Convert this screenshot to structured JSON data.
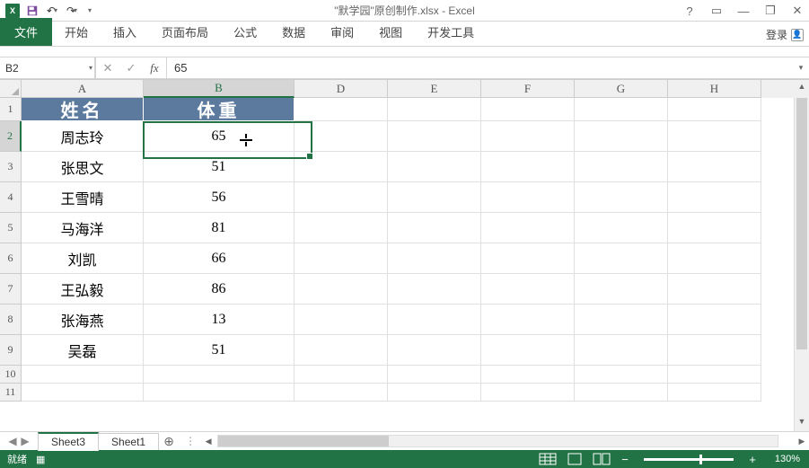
{
  "app": {
    "title": "\"默学园\"原创制作.xlsx - Excel"
  },
  "qat": {
    "undo": "↶",
    "redo": "↷"
  },
  "winbuttons": {
    "help": "?",
    "ribbon": "▭",
    "min": "—",
    "restore": "❐",
    "close": "✕"
  },
  "ribbon": {
    "file": "文件",
    "tabs": [
      "开始",
      "插入",
      "页面布局",
      "公式",
      "数据",
      "审阅",
      "视图",
      "开发工具"
    ],
    "login": "登录"
  },
  "formula_bar": {
    "name_box": "B2",
    "cancel": "✕",
    "enter": "✓",
    "fx": "fx",
    "value": "65"
  },
  "columns": [
    "A",
    "B",
    "D",
    "E",
    "F",
    "G",
    "H"
  ],
  "selected_column": "B",
  "selected_row": "2",
  "header_row": {
    "a": "姓名",
    "b": "体重"
  },
  "data_rows": [
    {
      "n": "2",
      "a": "周志玲",
      "b": "65"
    },
    {
      "n": "3",
      "a": "张思文",
      "b": "51"
    },
    {
      "n": "4",
      "a": "王雪晴",
      "b": "56"
    },
    {
      "n": "5",
      "a": "马海洋",
      "b": "81"
    },
    {
      "n": "6",
      "a": "刘凯",
      "b": "66"
    },
    {
      "n": "7",
      "a": "王弘毅",
      "b": "86"
    },
    {
      "n": "8",
      "a": "张海燕",
      "b": "13"
    },
    {
      "n": "9",
      "a": "吴磊",
      "b": "51"
    }
  ],
  "empty_rows": [
    "10",
    "11"
  ],
  "sheets": {
    "active": "Sheet3",
    "other": "Sheet1",
    "add": "⊕"
  },
  "statusbar": {
    "status": "就绪",
    "macro": "▦",
    "zoom_minus": "−",
    "zoom_plus": "+",
    "zoom": "130%"
  },
  "chart_data": {
    "type": "table",
    "columns": [
      "姓名",
      "体重"
    ],
    "rows": [
      [
        "周志玲",
        65
      ],
      [
        "张思文",
        51
      ],
      [
        "王雪晴",
        56
      ],
      [
        "马海洋",
        81
      ],
      [
        "刘凯",
        66
      ],
      [
        "王弘毅",
        86
      ],
      [
        "张海燕",
        13
      ],
      [
        "吴磊",
        51
      ]
    ]
  }
}
